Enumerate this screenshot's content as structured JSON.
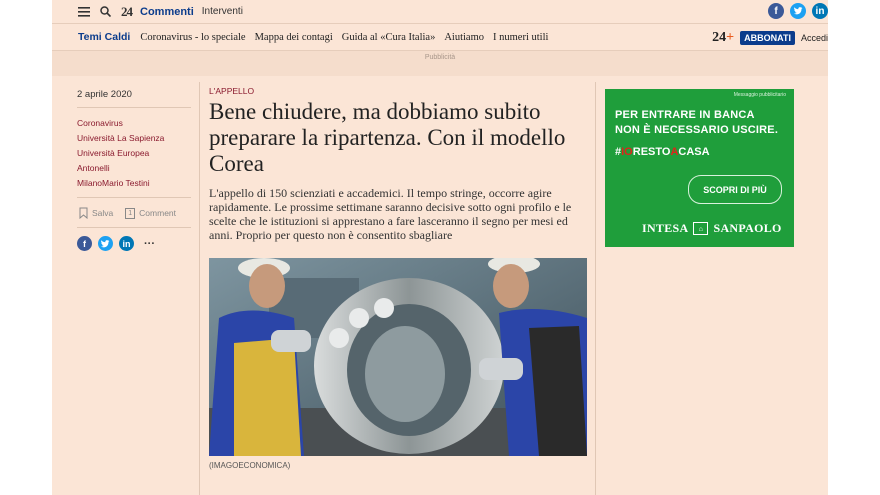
{
  "topbar": {
    "logo": "24",
    "section": "Commenti",
    "subsection": "Interventi"
  },
  "nav": {
    "hot_label": "Temi Caldi",
    "items": [
      "Coronavirus - lo speciale",
      "Mappa dei contagi",
      "Guida al «Cura Italia»",
      "Aiutiamo",
      "I numeri utili"
    ],
    "badge_num": "24",
    "badge_plus": "+",
    "subscribe": "ABBONATI",
    "login": "Accedi"
  },
  "ad_strip": {
    "label": "Pubblicità"
  },
  "sidebar": {
    "date": "2 aprile 2020",
    "tags": [
      "Coronavirus",
      "Università La Sapienza",
      "Università Europea",
      "Antonelli",
      "MilanoMario Testini"
    ],
    "save_label": "Salva",
    "comment_label": "Comment",
    "comment_count": "1",
    "more": "···"
  },
  "article": {
    "kicker": "L'APPELLO",
    "headline": "Bene chiudere, ma dobbiamo subito preparare la ripartenza. Con il modello Corea",
    "lead": "L'appello di 150 scienziati e accademici. Il tempo stringe, occorre agire rapidamente. Le prossime settimane saranno decisive sotto ogni profilo e le scelte che le istituzioni si apprestano a fare lasceranno il segno per mesi ed anni. Proprio per questo non è consentito sbagliare",
    "caption": "(IMAGOECONOMICA)"
  },
  "ad": {
    "message_label": "Messaggio pubblicitario",
    "line1": "PER ENTRARE IN BANCA",
    "line2": "NON È NECESSARIO USCIRE.",
    "hash": "#",
    "hash_red": "IO",
    "hash_mid": "RESTO",
    "hash_red2": "A",
    "hash_end": "CASA",
    "cta": "SCOPRI DI PIÙ",
    "brand_left": "INTESA",
    "brand_right": "SANPAOLO"
  },
  "colors": {
    "page_bg": "#fbe5d6",
    "brand_blue": "#0b3c8c",
    "tag_red": "#8a1a2e",
    "ad_green": "#1f9e3b"
  }
}
